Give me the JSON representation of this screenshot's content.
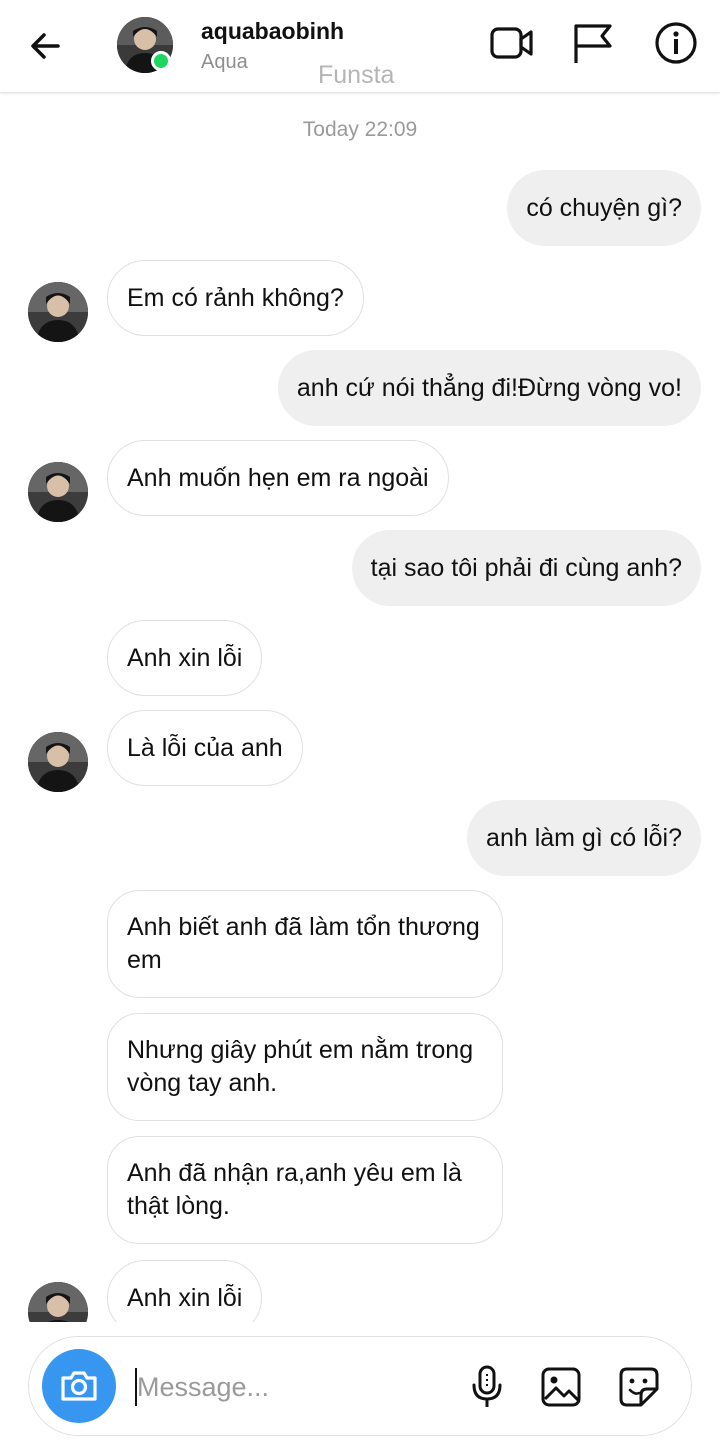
{
  "header": {
    "username": "aquabaobinh",
    "subname": "Aqua",
    "watermark": "Funsta",
    "icons": [
      "back-arrow-icon",
      "video-camera-icon",
      "flag-icon",
      "info-icon"
    ]
  },
  "chat": {
    "timestamp": "Today 22:09",
    "messages": [
      {
        "side": "out",
        "text": "có chuyện gì?"
      },
      {
        "side": "in",
        "text": "Em có rảnh không?"
      },
      {
        "side": "out",
        "text": "anh cứ nói thẳng đi!Đừng vòng vo!"
      },
      {
        "side": "in",
        "text": "Anh muốn hẹn em ra ngoài"
      },
      {
        "side": "out",
        "text": "tại sao tôi phải đi cùng anh?"
      },
      {
        "side": "in",
        "text": "Anh xin lỗi"
      },
      {
        "side": "in",
        "text": "Là lỗi của anh"
      },
      {
        "side": "out",
        "text": "anh làm gì có lỗi?"
      },
      {
        "side": "in",
        "text": "Anh biết anh đã làm tổn thương em"
      },
      {
        "side": "in",
        "text": "Nhưng giây phút em nằm trong vòng tay anh."
      },
      {
        "side": "in",
        "text": "Anh đã nhận ra,anh yêu em là thật lòng."
      },
      {
        "side": "in",
        "text": "Anh xin lỗi"
      }
    ]
  },
  "composer": {
    "placeholder": "Message...",
    "icons": [
      "camera-icon",
      "microphone-icon",
      "gallery-icon",
      "sticker-icon"
    ],
    "accent": "#3797f0"
  },
  "colors": {
    "online": "#1ed760",
    "bubble_out": "#efefef",
    "bubble_in_border": "#e0e0e0"
  }
}
